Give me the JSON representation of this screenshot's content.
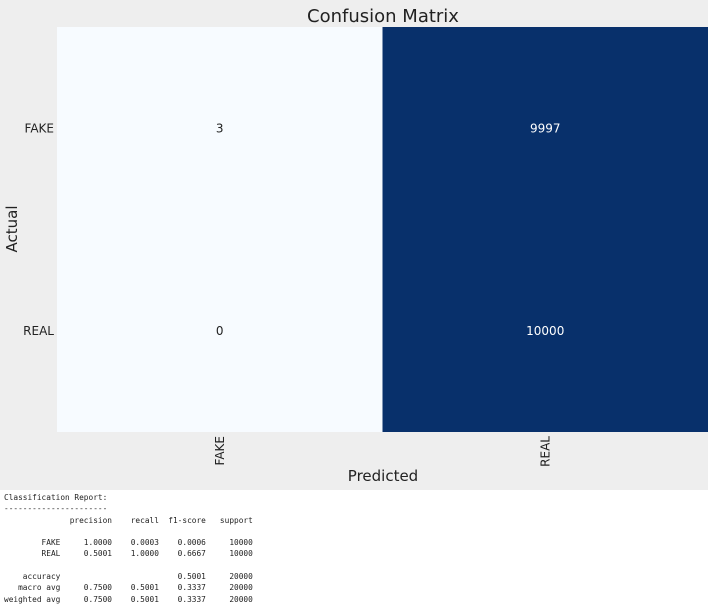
{
  "chart_data": {
    "type": "heatmap",
    "title": "Confusion Matrix",
    "xlabel": "Predicted",
    "ylabel": "Actual",
    "x_categories": [
      "FAKE",
      "REAL"
    ],
    "y_categories": [
      "FAKE",
      "REAL"
    ],
    "values": [
      [
        3,
        9997
      ],
      [
        0,
        10000
      ]
    ],
    "colormap": "Blues",
    "colors": {
      "low": "#f7fbff",
      "high": "#08306b",
      "figure_bg": "#eeeeee"
    },
    "colorbar": false
  },
  "report": {
    "title": "Classification Report:",
    "separator": "----------------------",
    "text": "              precision    recall  f1-score   support\n\n        FAKE     1.0000    0.0003    0.0006     10000\n        REAL     0.5001    1.0000    0.6667     10000\n\n    accuracy                         0.5001     20000\n   macro avg     0.7500    0.5001    0.3337     20000\nweighted avg     0.7500    0.5001    0.3337     20000"
  }
}
